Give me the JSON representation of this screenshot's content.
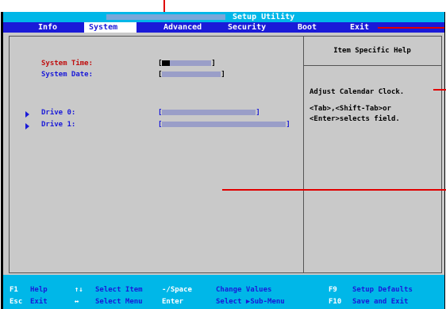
{
  "title": "Setup Utility",
  "menu": [
    {
      "label": "Info"
    },
    {
      "label": "System",
      "active": true
    },
    {
      "label": "Advanced"
    },
    {
      "label": "Security"
    },
    {
      "label": "Boot"
    },
    {
      "label": "Exit"
    }
  ],
  "fields": {
    "system_time_label": "System Time:",
    "system_date_label": "System Date:",
    "drive0_label": "Drive 0:",
    "drive1_label": "Drive 1:"
  },
  "help": {
    "header": "Item Specific Help",
    "line1": "Adjust Calendar Clock.",
    "line2": "<Tab>,<Shift-Tab>or",
    "line3": "<Enter>selects field."
  },
  "footer": {
    "row1": [
      {
        "key": "F1",
        "text": "Help"
      },
      {
        "key": "↑↓",
        "text": "Select Item"
      },
      {
        "key": "-/Space",
        "text": "Change Values"
      },
      {
        "key": "F9",
        "text": "Setup Defaults"
      }
    ],
    "row2": [
      {
        "key": "Esc",
        "text": "Exit"
      },
      {
        "key": "↔",
        "text": "Select Menu"
      },
      {
        "key": "Enter",
        "text": "Select ▶Sub-Menu"
      },
      {
        "key": "F10",
        "text": "Save and Exit"
      }
    ]
  },
  "colors": {
    "title_bg": "#00b7e8",
    "menu_bg": "#1a1ad8",
    "panel_bg": "#c9c9c9",
    "label_red": "#c01010",
    "label_blue": "#1a1ad8",
    "annotation": "#e00000"
  }
}
